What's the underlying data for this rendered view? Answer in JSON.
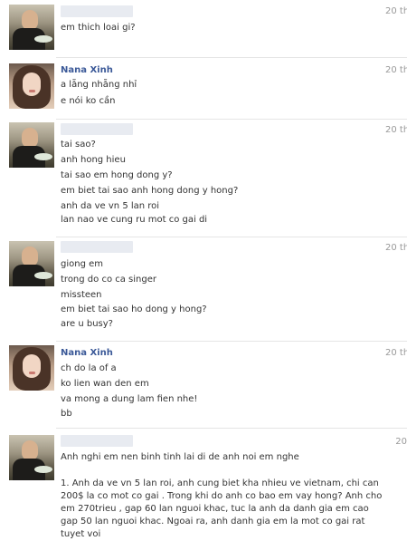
{
  "messages": [
    {
      "sender": "",
      "time": "20 th",
      "lines": [
        "em thich loai gi?"
      ]
    },
    {
      "sender": "Nana Xinh",
      "time": "20 th",
      "lines": [
        "a lẵng nhẵng nhỉ",
        "e nói ko cần"
      ]
    },
    {
      "sender": "",
      "time": "20 th",
      "lines": [
        "tai sao?",
        "anh hong hieu",
        "tai sao em hong dong y?",
        "em biet tai sao anh hong dong y hong?",
        "anh da ve vn 5 lan roi",
        "lan nao ve cung ru mot co gai di"
      ]
    },
    {
      "sender": "",
      "time": "20 th",
      "lines": [
        "giong em",
        "trong do co ca singer",
        "missteen",
        "em biet tai sao ho dong y hong?",
        "are u busy?"
      ]
    },
    {
      "sender": "Nana Xinh",
      "time": "20 th",
      "lines": [
        "ch do la of a",
        "ko lien wan den em",
        "va mong a dung lam fien nhe!",
        "bb"
      ]
    },
    {
      "sender": "",
      "time": "20",
      "lines": [
        "Anh nghi em nen binh tinh lai di de anh noi em nghe"
      ],
      "paragraph": "1. Anh da ve vn 5 lan roi, anh cung biet kha nhieu ve vietnam, chi can 200$ la co mot co gai . Trong khi do anh co bao em vay hong? Anh cho em 270trieu , gap 60 lan nguoi khac, tuc la anh da danh gia em cao gap 50 lan nguoi khac. Ngoai ra, anh danh gia em la mot co gai rat tuyet voi"
    }
  ]
}
